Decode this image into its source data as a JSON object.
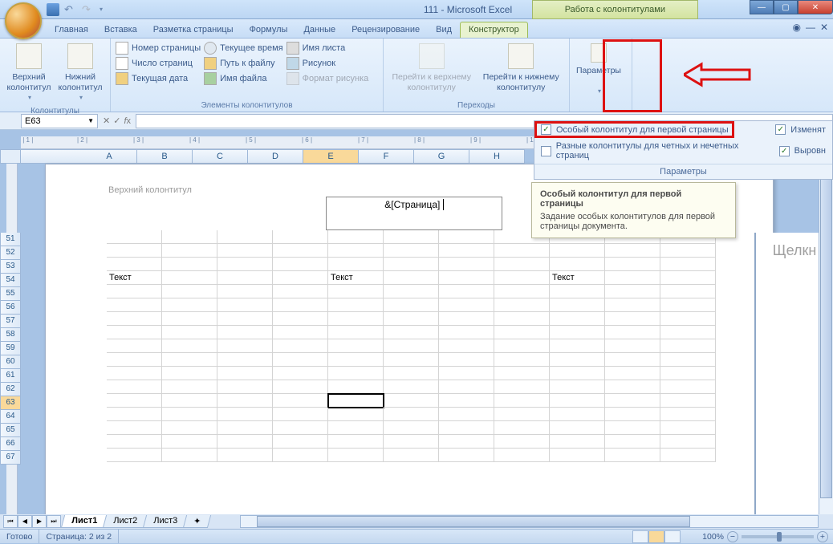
{
  "title": "111 - Microsoft Excel",
  "contextual_title": "Работа с колонтитулами",
  "tabs": {
    "home": "Главная",
    "insert": "Вставка",
    "layout": "Разметка страницы",
    "formulas": "Формулы",
    "data": "Данные",
    "review": "Рецензирование",
    "view": "Вид",
    "design": "Конструктор"
  },
  "ribbon": {
    "hf_group": "Колонтитулы",
    "top_hf": "Верхний колонтитул",
    "bottom_hf": "Нижний колонтитул",
    "elements_group": "Элементы колонтитулов",
    "page_num": "Номер страницы",
    "page_count": "Число страниц",
    "cur_date": "Текущая дата",
    "cur_time": "Текущее время",
    "file_path": "Путь к файлу",
    "file_name": "Имя файла",
    "sheet_name": "Имя листа",
    "picture": "Рисунок",
    "fmt_picture": "Формат рисунка",
    "nav_group": "Переходы",
    "goto_top": "Перейти к верхнему колонтитулу",
    "goto_bottom": "Перейти к нижнему колонтитулу",
    "options_group": "Параметры",
    "options_btn": "Параметры"
  },
  "namebox": "E63",
  "options": {
    "first_page": "Особый колонтитул для первой страницы",
    "odd_even": "Разные колонтитулы для четных и нечетных страниц",
    "change": "Изменят",
    "align": "Выровн",
    "footer": "Параметры"
  },
  "tooltip": {
    "title": "Особый колонтитул для первой страницы",
    "body": "Задание особых колонтитулов для первой страницы документа."
  },
  "page": {
    "hf_label": "Верхний колонтитул",
    "hf_content": "&[Страница]",
    "text": "Текст"
  },
  "rightpane": "Щелкн",
  "columns": [
    "A",
    "B",
    "C",
    "D",
    "E",
    "F",
    "G",
    "H"
  ],
  "rows": [
    "51",
    "52",
    "53",
    "54",
    "55",
    "56",
    "57",
    "58",
    "59",
    "60",
    "61",
    "62",
    "63",
    "64",
    "65",
    "66",
    "67"
  ],
  "active_row": "63",
  "sheets": {
    "s1": "Лист1",
    "s2": "Лист2",
    "s3": "Лист3"
  },
  "status": {
    "ready": "Готово",
    "page": "Страница: 2 из 2",
    "zoom": "100%"
  }
}
